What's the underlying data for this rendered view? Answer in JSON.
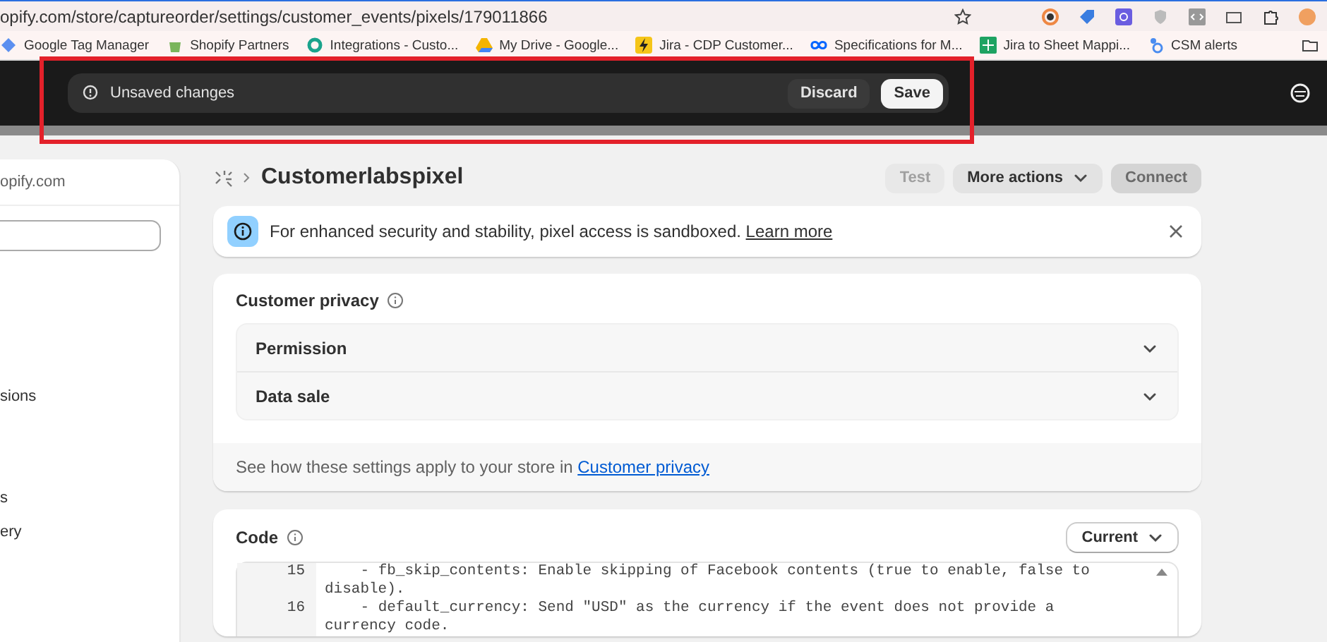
{
  "browser": {
    "url": "opify.com/store/captureorder/settings/customer_events/pixels/179011866",
    "bookmarks": [
      {
        "label": "Google Tag Manager",
        "kind": "tag"
      },
      {
        "label": "Shopify Partners",
        "kind": "bag"
      },
      {
        "label": "Integrations - Custo...",
        "kind": "ring"
      },
      {
        "label": "My Drive - Google...",
        "kind": "drive"
      },
      {
        "label": "Jira - CDP Customer...",
        "kind": "bolt"
      },
      {
        "label": "Specifications for M...",
        "kind": "loop"
      },
      {
        "label": "Jira to Sheet Mappi...",
        "kind": "sheet"
      },
      {
        "label": "CSM alerts",
        "kind": "drop"
      }
    ]
  },
  "unsaved_bar": {
    "message": "Unsaved changes",
    "buttons": [
      {
        "label": "Discard",
        "kind": "secondary"
      },
      {
        "label": "Save",
        "kind": "primary"
      }
    ]
  },
  "sidebar": {
    "store_domain": "opify.com",
    "items": [
      "sions",
      "s",
      "ery"
    ]
  },
  "page": {
    "title": "Customerlabspixel",
    "actions": [
      {
        "label": "Test",
        "kind": "plain",
        "disabled": true
      },
      {
        "label": "More actions",
        "kind": "menu",
        "disabled": false
      },
      {
        "label": "Connect",
        "kind": "primary",
        "disabled": true
      }
    ]
  },
  "banner": {
    "text": "For enhanced security and stability, pixel access is sandboxed.",
    "link": "Learn more"
  },
  "privacy": {
    "title": "Customer privacy",
    "rows": [
      {
        "label": "Permission",
        "expanded": false
      },
      {
        "label": "Data sale",
        "expanded": false
      }
    ],
    "footer_text": "See how these settings apply to your store in",
    "footer_link": "Customer privacy"
  },
  "code": {
    "title": "Code",
    "version": "Current",
    "lines": [
      {
        "number": "15",
        "text": "    - fb_skip_contents: Enable skipping of Facebook contents (true to enable, false to disable)."
      },
      {
        "number": "16",
        "text": "    - default_currency: Send \"USD\" as the currency if the event does not provide a currency code."
      }
    ]
  }
}
